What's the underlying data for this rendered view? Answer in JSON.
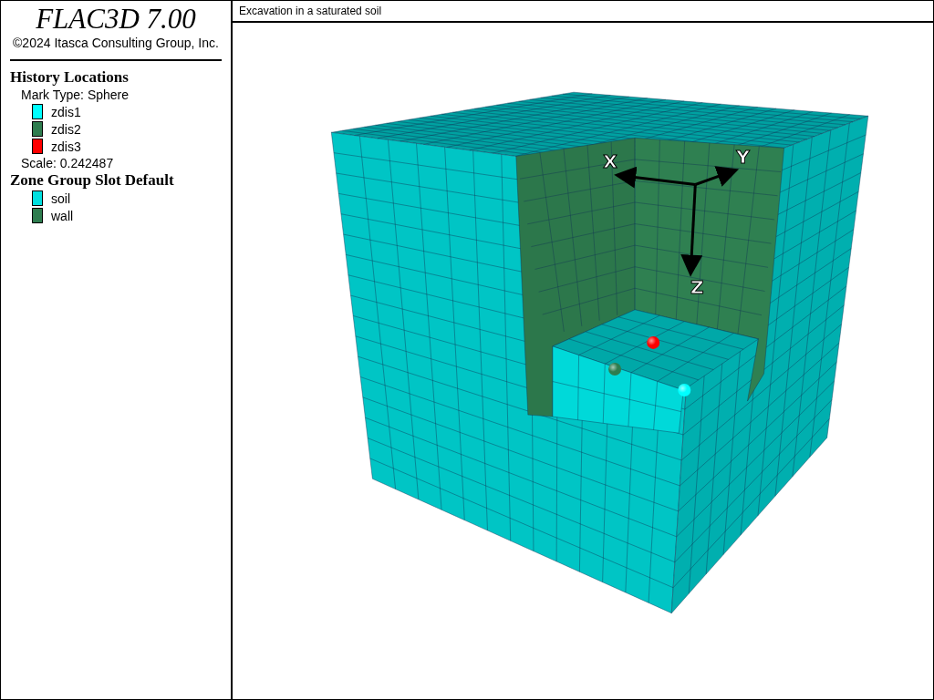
{
  "header": {
    "title": "FLAC3D 7.00",
    "copyright": "©2024 Itasca Consulting Group, Inc."
  },
  "legend": [
    {
      "heading": "History Locations",
      "lines": [
        "Mark Type: Sphere"
      ],
      "items": [
        {
          "label": "zdis1",
          "color": "#00ffff"
        },
        {
          "label": "zdis2",
          "color": "#2e7d4f"
        },
        {
          "label": "zdis3",
          "color": "#ff0000"
        }
      ],
      "footer": "Scale: 0.242487"
    },
    {
      "heading": "Zone Group Slot Default",
      "items": [
        {
          "label": "soil",
          "color": "#00e0e0"
        },
        {
          "label": "wall",
          "color": "#2e7d4f"
        }
      ]
    }
  ],
  "plot": {
    "title": "Excavation in a saturated soil",
    "axes": [
      "X",
      "Y",
      "Z"
    ]
  }
}
